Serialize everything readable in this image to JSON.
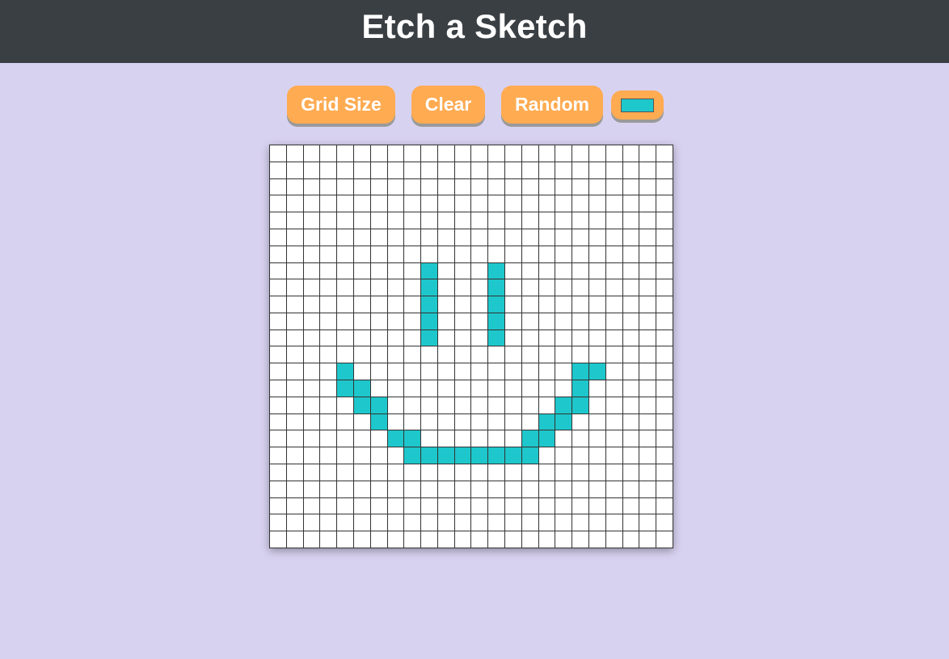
{
  "header": {
    "title": "Etch a Sketch"
  },
  "controls": {
    "grid_size_label": "Grid Size",
    "clear_label": "Clear",
    "random_label": "Random",
    "selected_color": "#1ec7cb"
  },
  "colors": {
    "background": "#d8d2f1",
    "header": "#3a3f44",
    "button": "#ffab52",
    "cell_empty": "#ffffff",
    "grid_line": "#333333"
  },
  "grid": {
    "size": 24,
    "painted_cells": [
      [
        7,
        9
      ],
      [
        8,
        9
      ],
      [
        9,
        9
      ],
      [
        10,
        9
      ],
      [
        11,
        9
      ],
      [
        7,
        13
      ],
      [
        8,
        13
      ],
      [
        9,
        13
      ],
      [
        10,
        13
      ],
      [
        11,
        13
      ],
      [
        13,
        4
      ],
      [
        14,
        4
      ],
      [
        14,
        5
      ],
      [
        15,
        5
      ],
      [
        15,
        6
      ],
      [
        16,
        6
      ],
      [
        17,
        7
      ],
      [
        17,
        8
      ],
      [
        18,
        8
      ],
      [
        18,
        9
      ],
      [
        18,
        10
      ],
      [
        18,
        11
      ],
      [
        18,
        12
      ],
      [
        18,
        13
      ],
      [
        18,
        14
      ],
      [
        18,
        15
      ],
      [
        17,
        15
      ],
      [
        17,
        16
      ],
      [
        16,
        16
      ],
      [
        16,
        17
      ],
      [
        15,
        17
      ],
      [
        15,
        18
      ],
      [
        14,
        18
      ],
      [
        13,
        18
      ],
      [
        13,
        19
      ]
    ]
  }
}
